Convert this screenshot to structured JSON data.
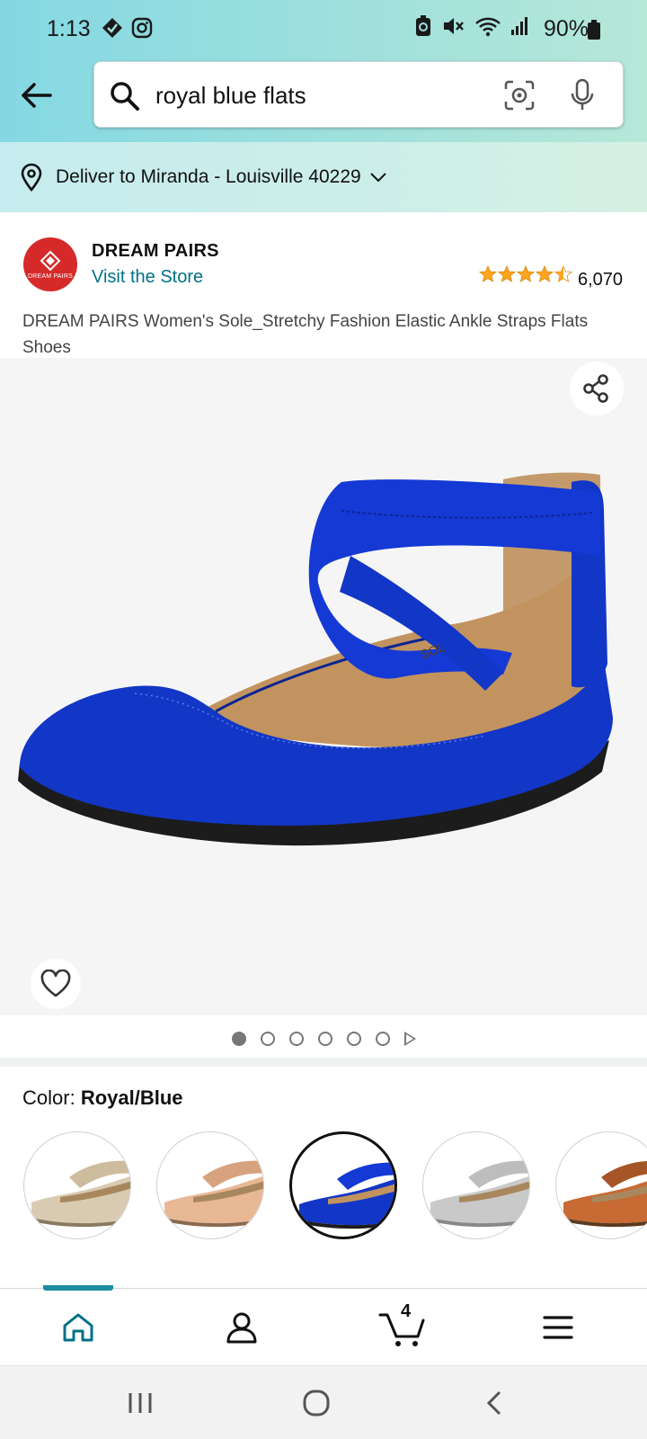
{
  "status_bar": {
    "time": "1:13",
    "battery": "90%"
  },
  "search": {
    "query": "royal blue flats"
  },
  "delivery": {
    "text": "Deliver to Miranda - Louisville 40229"
  },
  "brand": {
    "logo_text": "DREAM PAIRS",
    "name": "DREAM PAIRS",
    "visit_store": "Visit the Store",
    "rating_stars": 4.5,
    "rating_count": "6,070"
  },
  "product": {
    "title": "DREAM PAIRS Women's Sole_Stretchy Fashion Elastic Ankle Straps Flats Shoes",
    "image_count": 6,
    "active_image_index": 0
  },
  "color": {
    "label": "Color:",
    "selected": "Royal/Blue",
    "swatches": [
      {
        "color": "#d9cbb2",
        "strap": "#cdbd9e",
        "selected": false
      },
      {
        "color": "#e8b894",
        "strap": "#d7a37e",
        "selected": false
      },
      {
        "color": "#1236c6",
        "strap": "#1236c6",
        "selected": true
      },
      {
        "color": "#c9c9c9",
        "strap": "#bdbdbd",
        "selected": false
      },
      {
        "color": "#c86a33",
        "strap": "#a65528",
        "selected": false
      }
    ]
  },
  "bottom_nav": {
    "cart_count": "4"
  },
  "colors": {
    "accent": "#007185",
    "nav_indicator": "#1d8da0",
    "brand_red": "#d62a2a",
    "star": "#ffa41c",
    "shoe_blue": "#1236c6"
  }
}
